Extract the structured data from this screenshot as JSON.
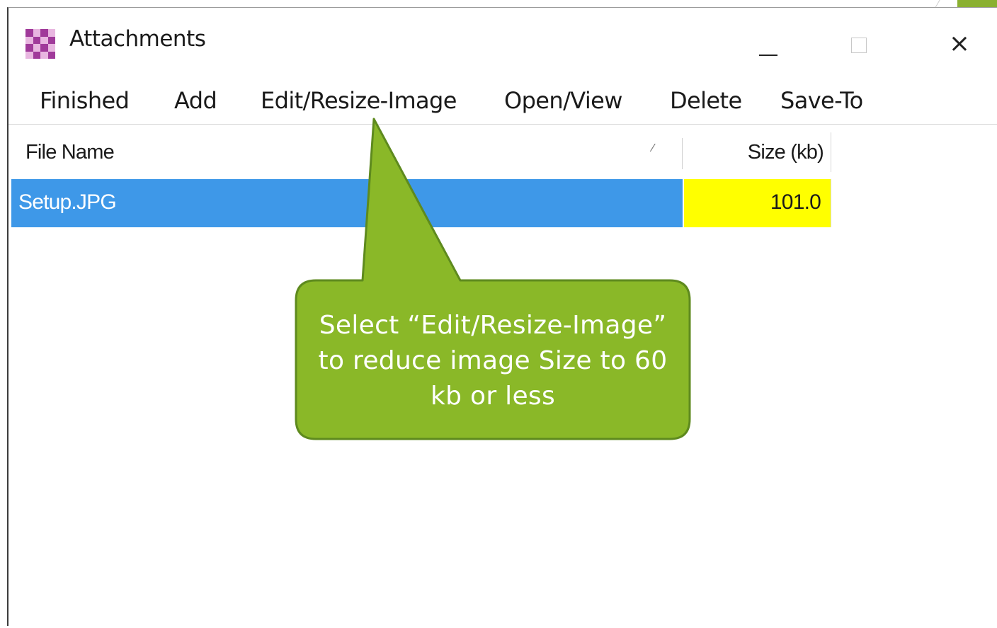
{
  "window": {
    "title": "Attachments",
    "icon": "checkerboard-app-icon",
    "controls": {
      "minimize": "minimize-icon",
      "maximize": "maximize-icon",
      "close": "×"
    }
  },
  "menu": [
    {
      "label": "Finished"
    },
    {
      "label": "Add"
    },
    {
      "label": "Edit/Resize-Image"
    },
    {
      "label": "Open/View"
    },
    {
      "label": "Delete"
    },
    {
      "label": "Save-To"
    }
  ],
  "list": {
    "columns": [
      "File Name",
      "Size (kb)"
    ],
    "sort_indicator": "⁄",
    "rows": [
      {
        "file_name": "Setup.JPG",
        "size": "101.0",
        "selected": true
      }
    ]
  },
  "callout": {
    "text": "Select “Edit/Resize-Image” to reduce image Size to 60 kb or less",
    "fill": "#8ab828",
    "border": "#5e8a1e"
  },
  "colors": {
    "selection": "#3e98e8",
    "size_highlight": "#ffff00"
  }
}
